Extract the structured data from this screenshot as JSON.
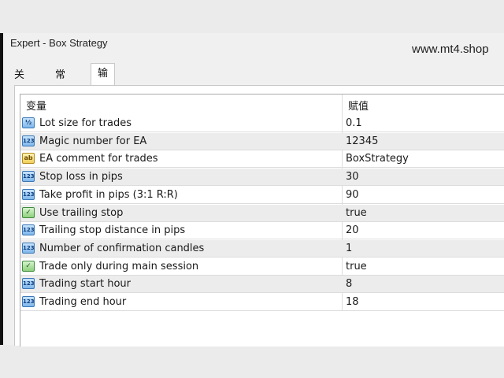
{
  "window": {
    "title": "Expert - Box Strategy",
    "watermark": "www.mt4.shop"
  },
  "tabs": [
    {
      "label": "关于",
      "active": false
    },
    {
      "label": "常用",
      "active": false
    },
    {
      "label": "输入参数",
      "active": true
    }
  ],
  "table": {
    "headers": {
      "variable": "变量",
      "value": "赋值"
    },
    "rows": [
      {
        "icon": "double",
        "glyph": "½",
        "name": "Lot size for trades",
        "value": "0.1"
      },
      {
        "icon": "int",
        "glyph": "123",
        "name": "Magic number for EA",
        "value": "12345"
      },
      {
        "icon": "string",
        "glyph": "ab",
        "name": "EA comment for trades",
        "value": "BoxStrategy"
      },
      {
        "icon": "int",
        "glyph": "123",
        "name": "Stop loss in pips",
        "value": "30"
      },
      {
        "icon": "int",
        "glyph": "123",
        "name": "Take profit in pips (3:1 R:R)",
        "value": "90"
      },
      {
        "icon": "bool",
        "glyph": "✓",
        "name": "Use trailing stop",
        "value": "true"
      },
      {
        "icon": "int",
        "glyph": "123",
        "name": "Trailing stop distance in pips",
        "value": "20"
      },
      {
        "icon": "int",
        "glyph": "123",
        "name": "Number of confirmation candles",
        "value": "1"
      },
      {
        "icon": "bool",
        "glyph": "✓",
        "name": "Trade only during main session",
        "value": "true"
      },
      {
        "icon": "int",
        "glyph": "123",
        "name": "Trading start hour",
        "value": "8"
      },
      {
        "icon": "int",
        "glyph": "123",
        "name": "Trading end hour",
        "value": "18"
      }
    ]
  }
}
